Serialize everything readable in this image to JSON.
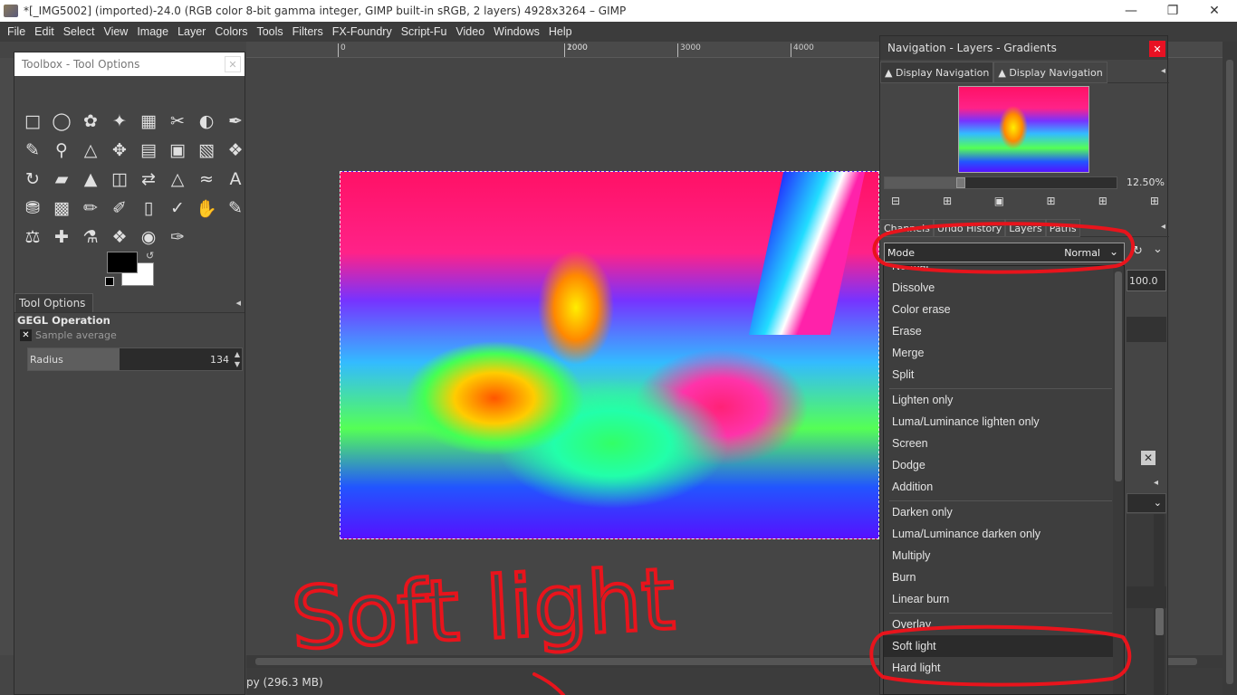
{
  "window": {
    "title": "*[_IMG5002] (imported)-24.0 (RGB color 8-bit gamma integer, GIMP built-in sRGB, 2 layers) 4928x3264 – GIMP"
  },
  "menubar": [
    "File",
    "Edit",
    "Select",
    "View",
    "Image",
    "Layer",
    "Colors",
    "Tools",
    "Filters",
    "FX-Foundry",
    "Script-Fu",
    "Video",
    "Windows",
    "Help"
  ],
  "ruler": {
    "ticks": [
      "0",
      "1000",
      "2000",
      "3000",
      "4000"
    ]
  },
  "toolbox": {
    "title": "Toolbox - Tool Options",
    "tab": "Tool Options",
    "operation": "GEGL Operation",
    "sample_average": "Sample average",
    "radius_label": "Radius",
    "radius_value": "134",
    "radius_fraction": 0.43
  },
  "status": {
    "memory": "py (296.3 MB)"
  },
  "dock": {
    "title": "Navigation - Layers - Gradients",
    "nav_tabs": [
      "Display Navigation",
      "Display Navigation"
    ],
    "zoom": "12.50%",
    "zoom_fraction": 0.31,
    "layer_tabs": [
      "Channels",
      "Undo History",
      "Layers",
      "Paths"
    ],
    "mode_label": "Mode",
    "mode_value": "Normal",
    "opacity": "100.0"
  },
  "dropdown": {
    "items": [
      {
        "label": "Normal",
        "group": 1
      },
      {
        "label": "Dissolve",
        "group": 1
      },
      {
        "label": "Color erase",
        "group": 1
      },
      {
        "label": "Erase",
        "group": 1
      },
      {
        "label": "Merge",
        "group": 1
      },
      {
        "label": "Split",
        "group": 1
      },
      {
        "label": "Lighten only",
        "group": 2
      },
      {
        "label": "Luma/Luminance lighten only",
        "group": 2
      },
      {
        "label": "Screen",
        "group": 2
      },
      {
        "label": "Dodge",
        "group": 2
      },
      {
        "label": "Addition",
        "group": 2
      },
      {
        "label": "Darken only",
        "group": 3
      },
      {
        "label": "Luma/Luminance darken only",
        "group": 3
      },
      {
        "label": "Multiply",
        "group": 3
      },
      {
        "label": "Burn",
        "group": 3
      },
      {
        "label": "Linear burn",
        "group": 3
      },
      {
        "label": "Overlay",
        "group": 4
      },
      {
        "label": "Soft light",
        "group": 4,
        "selected": true
      },
      {
        "label": "Hard light",
        "group": 4
      }
    ]
  },
  "annotation": {
    "text": "Soft light",
    "color": "#e8141c"
  }
}
